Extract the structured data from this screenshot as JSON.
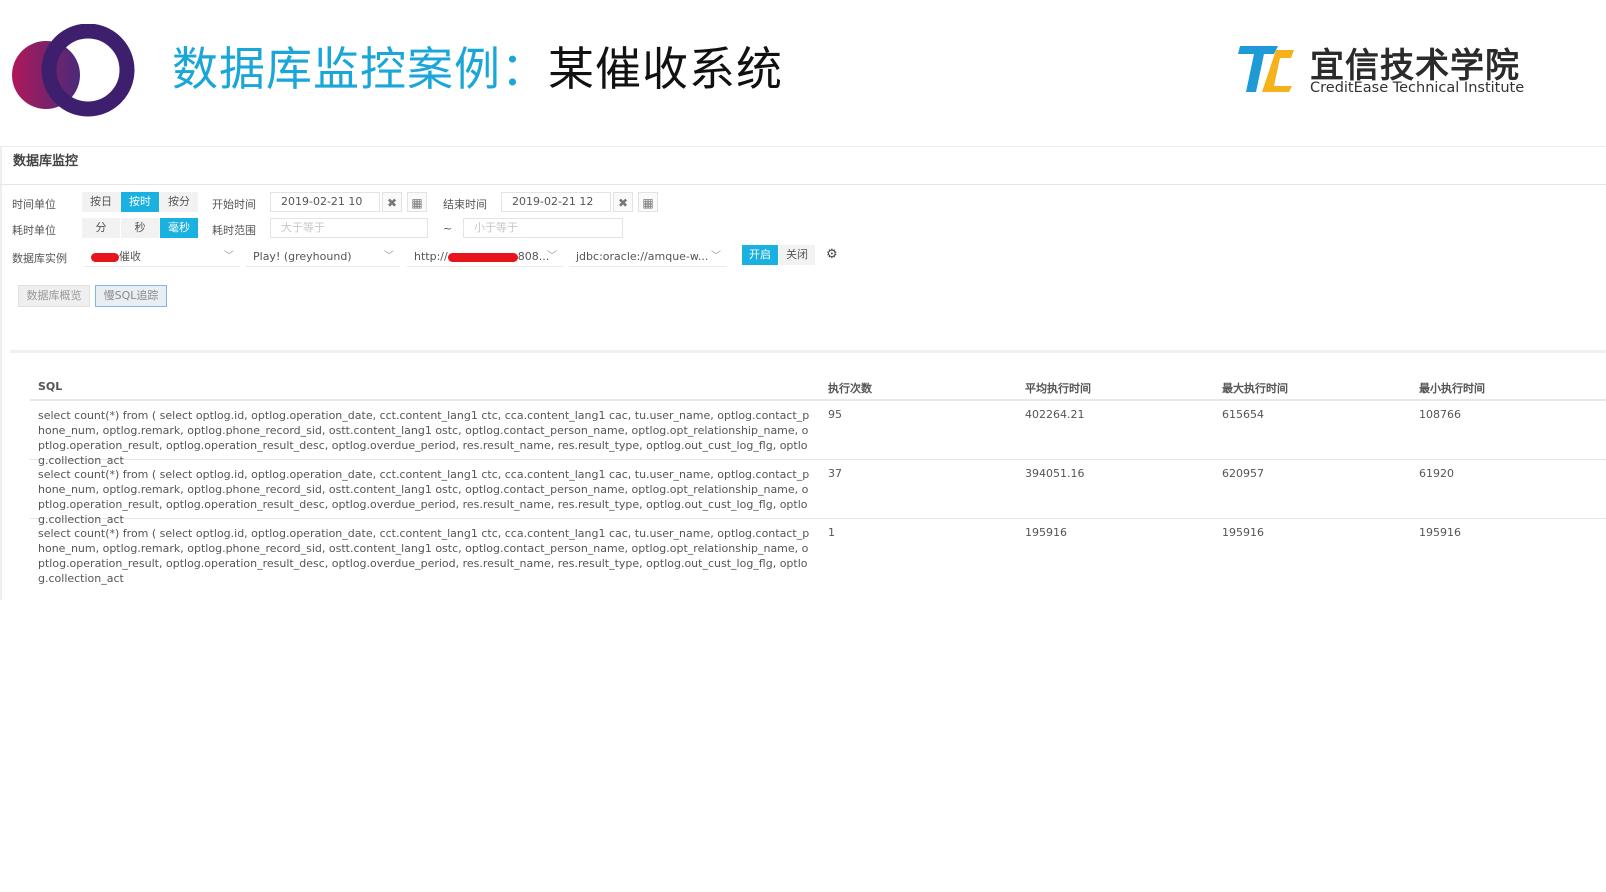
{
  "slide": {
    "title_prefix": "数据库监控案例：",
    "title_suffix": "某催收系统",
    "brand_cn": "宜信技术学院",
    "brand_en": "CreditEase Technical Institute",
    "colors": {
      "title_accent": "#1aa6d8",
      "brand_blue": "#1e9ad6",
      "brand_yellow": "#f5b21a",
      "logo_purple": "#4a2a7a",
      "logo_magenta": "#b0185a"
    }
  },
  "panel": {
    "title": "数据库监控",
    "time_unit": {
      "label": "时间单位",
      "options": [
        "按日",
        "按时",
        "按分"
      ],
      "selected": "按时"
    },
    "start_time": {
      "label": "开始时间",
      "value": "2019-02-21 10"
    },
    "end_time": {
      "label": "结束时间",
      "value": "2019-02-21 12"
    },
    "duration_unit": {
      "label": "耗时单位",
      "options": [
        "分",
        "秒",
        "毫秒"
      ],
      "selected": "毫秒"
    },
    "duration_range": {
      "label": "耗时范围",
      "min_placeholder": "大于等于",
      "separator": "~",
      "max_placeholder": "小于等于"
    },
    "db_instance": {
      "label": "数据库实例",
      "system_value_suffix": "催收",
      "app_value": "Play! (greyhound)",
      "url_prefix": "http://",
      "url_suffix": "808...",
      "jdbc_value": "jdbc:oracle://amque-w..."
    },
    "toggle": {
      "on": "开启",
      "off": "关闭",
      "selected": "开启"
    },
    "settings_icon": "gear-icon",
    "tabs": [
      "数据库概览",
      "慢SQL追踪"
    ],
    "active_tab": "慢SQL追踪"
  },
  "table": {
    "columns": [
      "SQL",
      "执行次数",
      "平均执行时间",
      "最大执行时间",
      "最小执行时间"
    ],
    "rows": [
      {
        "sql": "select count(*) from ( select optlog.id, optlog.operation_date, cct.content_lang1 ctc, cca.content_lang1 cac, tu.user_name, optlog.contact_phone_num, optlog.remark, optlog.phone_record_sid, ostt.content_lang1 ostc, optlog.contact_person_name, optlog.opt_relationship_name, optlog.operation_result, optlog.operation_result_desc, optlog.overdue_period, res.result_name, res.result_type, optlog.out_cust_log_flg, optlog.collection_act",
        "count": "95",
        "avg": "402264.21",
        "max": "615654",
        "min": "108766"
      },
      {
        "sql": "select count(*) from ( select optlog.id, optlog.operation_date, cct.content_lang1 ctc, cca.content_lang1 cac, tu.user_name, optlog.contact_phone_num, optlog.remark, optlog.phone_record_sid, ostt.content_lang1 ostc, optlog.contact_person_name, optlog.opt_relationship_name, optlog.operation_result, optlog.operation_result_desc, optlog.overdue_period, res.result_name, res.result_type, optlog.out_cust_log_flg, optlog.collection_act",
        "count": "37",
        "avg": "394051.16",
        "max": "620957",
        "min": "61920"
      },
      {
        "sql": "select count(*) from ( select optlog.id, optlog.operation_date, cct.content_lang1 ctc, cca.content_lang1 cac, tu.user_name, optlog.contact_phone_num, optlog.remark, optlog.phone_record_sid, ostt.content_lang1 ostc, optlog.contact_person_name, optlog.opt_relationship_name, optlog.operation_result, optlog.operation_result_desc, optlog.overdue_period, res.result_name, res.result_type, optlog.out_cust_log_flg, optlog.collection_act",
        "count": "1",
        "avg": "195916",
        "max": "195916",
        "min": "195916"
      }
    ]
  }
}
